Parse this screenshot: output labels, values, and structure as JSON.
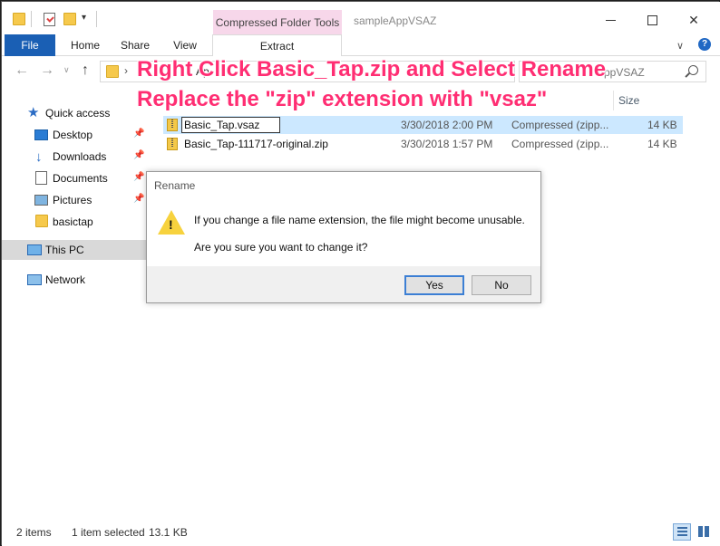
{
  "window": {
    "title": "sampleAppVSAZ",
    "contextual_tab_header": "Compressed Folder Tools",
    "controls": {
      "minimize": "minimize",
      "maximize": "maximize",
      "close": "✕"
    }
  },
  "ribbon": {
    "tabs": [
      {
        "label": "File"
      },
      {
        "label": "Home"
      },
      {
        "label": "Share"
      },
      {
        "label": "View"
      },
      {
        "label": "Extract"
      }
    ],
    "help": "?"
  },
  "address": {
    "visible_fragment": "Ap",
    "search_placeholder": "AppVSAZ"
  },
  "nav": {
    "items": [
      {
        "label": "Quick access",
        "icon": "star-icon"
      },
      {
        "label": "Desktop",
        "icon": "desktop-icon"
      },
      {
        "label": "Downloads",
        "icon": "download-icon"
      },
      {
        "label": "Documents",
        "icon": "documents-icon"
      },
      {
        "label": "Pictures",
        "icon": "pictures-icon"
      },
      {
        "label": "basictap",
        "icon": "folder-icon"
      },
      {
        "label": "This PC",
        "icon": "computer-icon"
      },
      {
        "label": "Network",
        "icon": "network-icon"
      }
    ]
  },
  "files": {
    "column_size": "Size",
    "rows": [
      {
        "name": "Basic_Tap.vsaz",
        "date": "3/30/2018 2:00 PM",
        "type": "Compressed (zipp...",
        "size": "14 KB",
        "selected": true
      },
      {
        "name": "Basic_Tap-111717-original.zip",
        "date": "3/30/2018 1:57 PM",
        "type": "Compressed (zipp...",
        "size": "14 KB",
        "selected": false
      }
    ]
  },
  "annotation": {
    "line1": "Right Click Basic_Tap.zip and Select Rename",
    "line2": "Replace the \"zip\" extension with \"vsaz\"",
    "color": "#ff2e73"
  },
  "dialog": {
    "title": "Rename",
    "warning_mark": "!",
    "message1": "If you change a file name extension, the file might become unusable.",
    "message2": "Are you sure you want to change it?",
    "yes_label": "Yes",
    "no_label": "No"
  },
  "status": {
    "item_count": "2 items",
    "selected": "1 item selected",
    "selected_size": "13.1 KB"
  }
}
